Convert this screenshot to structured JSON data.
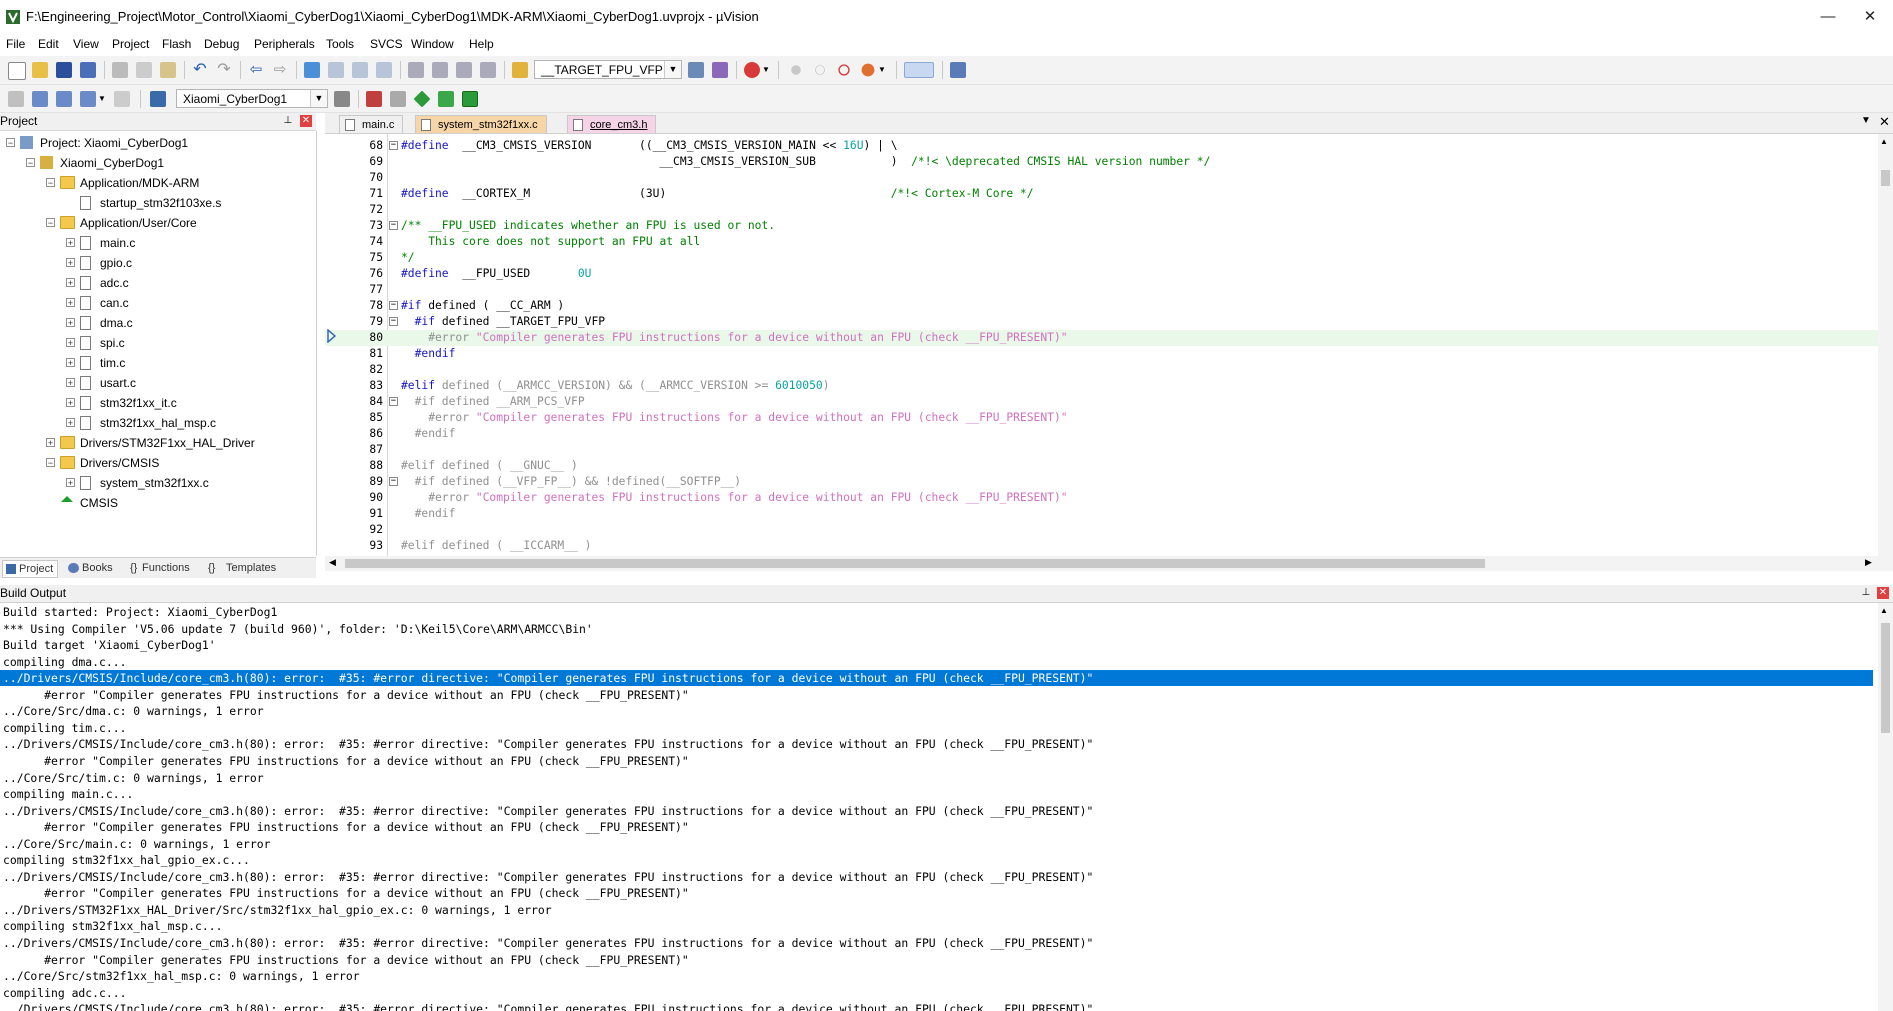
{
  "window": {
    "title": "F:\\Engineering_Project\\Motor_Control\\Xiaomi_CyberDog1\\Xiaomi_CyberDog1\\MDK-ARM\\Xiaomi_CyberDog1.uvprojx - µVision",
    "minimize": "—",
    "maximize": "☐",
    "close": "✕"
  },
  "menu": [
    "File",
    "Edit",
    "View",
    "Project",
    "Flash",
    "Debug",
    "Peripherals",
    "Tools",
    "SVCS",
    "Window",
    "Help"
  ],
  "toolbar": {
    "target_combo": "__TARGET_FPU_VFP",
    "project_combo": "Xiaomi_CyberDog1"
  },
  "project_panel": {
    "title": "Project",
    "tree": [
      {
        "label": "Project: Xiaomi_CyberDog1",
        "level": 0,
        "type": "project",
        "exp": "−"
      },
      {
        "label": "Xiaomi_CyberDog1",
        "level": 1,
        "type": "target",
        "exp": "−"
      },
      {
        "label": "Application/MDK-ARM",
        "level": 2,
        "type": "folder",
        "exp": "−"
      },
      {
        "label": "startup_stm32f103xe.s",
        "level": 3,
        "type": "file",
        "exp": ""
      },
      {
        "label": "Application/User/Core",
        "level": 2,
        "type": "folder",
        "exp": "−"
      },
      {
        "label": "main.c",
        "level": 3,
        "type": "file",
        "exp": "+"
      },
      {
        "label": "gpio.c",
        "level": 3,
        "type": "file",
        "exp": "+"
      },
      {
        "label": "adc.c",
        "level": 3,
        "type": "file",
        "exp": "+"
      },
      {
        "label": "can.c",
        "level": 3,
        "type": "file",
        "exp": "+"
      },
      {
        "label": "dma.c",
        "level": 3,
        "type": "file",
        "exp": "+"
      },
      {
        "label": "spi.c",
        "level": 3,
        "type": "file",
        "exp": "+"
      },
      {
        "label": "tim.c",
        "level": 3,
        "type": "file",
        "exp": "+"
      },
      {
        "label": "usart.c",
        "level": 3,
        "type": "file",
        "exp": "+"
      },
      {
        "label": "stm32f1xx_it.c",
        "level": 3,
        "type": "file",
        "exp": "+"
      },
      {
        "label": "stm32f1xx_hal_msp.c",
        "level": 3,
        "type": "file",
        "exp": "+"
      },
      {
        "label": "Drivers/STM32F1xx_HAL_Driver",
        "level": 2,
        "type": "folder",
        "exp": "+"
      },
      {
        "label": "Drivers/CMSIS",
        "level": 2,
        "type": "folder",
        "exp": "−"
      },
      {
        "label": "system_stm32f1xx.c",
        "level": 3,
        "type": "file",
        "exp": "+"
      },
      {
        "label": "CMSIS",
        "level": 2,
        "type": "gem",
        "exp": ""
      }
    ],
    "bottom_tabs": [
      "Project",
      "Books",
      "Functions",
      "Templates"
    ]
  },
  "editor": {
    "tabs": [
      {
        "label": "main.c",
        "active": false,
        "color": "#f0f0f0"
      },
      {
        "label": "system_stm32f1xx.c",
        "active": false,
        "color": "#f6d6a8"
      },
      {
        "label": "core_cm3.h",
        "active": true,
        "color": "#f4d4e6"
      }
    ],
    "lines": [
      {
        "n": "68",
        "fold": "−",
        "hl": false,
        "segs": [
          [
            "kw",
            "#define"
          ],
          [
            "",
            "  __CM3_CMSIS_VERSION       ((__CM3_CMSIS_VERSION_MAIN << "
          ],
          [
            "num",
            "16U"
          ],
          [
            "",
            ") | \\"
          ]
        ]
      },
      {
        "n": "69",
        "fold": "",
        "hl": false,
        "segs": [
          [
            "",
            "                                      __CM3_CMSIS_VERSION_SUB           )  "
          ],
          [
            "cm",
            "/*!< \\deprecated CMSIS HAL version number */"
          ]
        ]
      },
      {
        "n": "70",
        "fold": "",
        "hl": false,
        "segs": [
          [
            "",
            ""
          ]
        ]
      },
      {
        "n": "71",
        "fold": "",
        "hl": false,
        "segs": [
          [
            "kw",
            "#define"
          ],
          [
            "",
            "  __CORTEX_M                (3U)                                 "
          ],
          [
            "cm",
            "/*!< Cortex-M Core */"
          ]
        ]
      },
      {
        "n": "72",
        "fold": "",
        "hl": false,
        "segs": [
          [
            "",
            ""
          ]
        ]
      },
      {
        "n": "73",
        "fold": "−",
        "hl": false,
        "segs": [
          [
            "cm",
            "/** __FPU_USED indicates whether an FPU is used or not."
          ]
        ]
      },
      {
        "n": "74",
        "fold": "",
        "hl": false,
        "segs": [
          [
            "cm",
            "    This core does not support an FPU at all"
          ]
        ]
      },
      {
        "n": "75",
        "fold": "",
        "hl": false,
        "segs": [
          [
            "cm",
            "*/"
          ]
        ]
      },
      {
        "n": "76",
        "fold": "",
        "hl": false,
        "segs": [
          [
            "kw",
            "#define"
          ],
          [
            "",
            "  __FPU_USED       "
          ],
          [
            "num",
            "0U"
          ]
        ]
      },
      {
        "n": "77",
        "fold": "",
        "hl": false,
        "segs": [
          [
            "",
            ""
          ]
        ]
      },
      {
        "n": "78",
        "fold": "−",
        "hl": false,
        "segs": [
          [
            "kw",
            "#if"
          ],
          [
            "",
            " defined ( __CC_ARM )"
          ]
        ]
      },
      {
        "n": "79",
        "fold": "−",
        "hl": false,
        "segs": [
          [
            "",
            "  "
          ],
          [
            "kw",
            "#if"
          ],
          [
            "",
            " defined __TARGET_FPU_VFP"
          ]
        ]
      },
      {
        "n": "80",
        "fold": "",
        "hl": true,
        "segs": [
          [
            "dim",
            "    #error "
          ],
          [
            "lstr",
            "\"Compiler generates FPU instructions for a device without an FPU (check __FPU_PRESENT)\""
          ]
        ]
      },
      {
        "n": "81",
        "fold": "",
        "hl": false,
        "segs": [
          [
            "",
            "  "
          ],
          [
            "kw",
            "#endif"
          ]
        ]
      },
      {
        "n": "82",
        "fold": "",
        "hl": false,
        "segs": [
          [
            "",
            ""
          ]
        ]
      },
      {
        "n": "83",
        "fold": "",
        "hl": false,
        "segs": [
          [
            "kw",
            "#elif"
          ],
          [
            "dim",
            " defined (__ARMCC_VERSION) && (__ARMCC_VERSION >= "
          ],
          [
            "num",
            "6010050"
          ],
          [
            "dim",
            ")"
          ]
        ]
      },
      {
        "n": "84",
        "fold": "−",
        "hl": false,
        "segs": [
          [
            "dim",
            "  #if defined __ARM_PCS_VFP"
          ]
        ]
      },
      {
        "n": "85",
        "fold": "",
        "hl": false,
        "segs": [
          [
            "dim",
            "    #error "
          ],
          [
            "lstr",
            "\"Compiler generates FPU instructions for a device without an FPU (check __FPU_PRESENT)\""
          ]
        ]
      },
      {
        "n": "86",
        "fold": "",
        "hl": false,
        "segs": [
          [
            "dim",
            "  #endif"
          ]
        ]
      },
      {
        "n": "87",
        "fold": "",
        "hl": false,
        "segs": [
          [
            "",
            ""
          ]
        ]
      },
      {
        "n": "88",
        "fold": "",
        "hl": false,
        "segs": [
          [
            "dim",
            "#elif defined ( __GNUC__ )"
          ]
        ]
      },
      {
        "n": "89",
        "fold": "−",
        "hl": false,
        "segs": [
          [
            "dim",
            "  #if defined (__VFP_FP__) && !defined(__SOFTFP__)"
          ]
        ]
      },
      {
        "n": "90",
        "fold": "",
        "hl": false,
        "segs": [
          [
            "dim",
            "    #error "
          ],
          [
            "lstr",
            "\"Compiler generates FPU instructions for a device without an FPU (check __FPU_PRESENT)\""
          ]
        ]
      },
      {
        "n": "91",
        "fold": "",
        "hl": false,
        "segs": [
          [
            "dim",
            "  #endif"
          ]
        ]
      },
      {
        "n": "92",
        "fold": "",
        "hl": false,
        "segs": [
          [
            "",
            ""
          ]
        ]
      },
      {
        "n": "93",
        "fold": "",
        "hl": false,
        "segs": [
          [
            "dim",
            "#elif defined ( __ICCARM__ )"
          ]
        ]
      }
    ]
  },
  "build_output": {
    "title": "Build Output",
    "selected_index": 4,
    "lines": [
      "Build started: Project: Xiaomi_CyberDog1",
      "*** Using Compiler 'V5.06 update 7 (build 960)', folder: 'D:\\Keil5\\Core\\ARM\\ARMCC\\Bin'",
      "Build target 'Xiaomi_CyberDog1'",
      "compiling dma.c...",
      "../Drivers/CMSIS/Include/core_cm3.h(80): error:  #35: #error directive: \"Compiler generates FPU instructions for a device without an FPU (check __FPU_PRESENT)\"",
      "      #error \"Compiler generates FPU instructions for a device without an FPU (check __FPU_PRESENT)\"",
      "../Core/Src/dma.c: 0 warnings, 1 error",
      "compiling tim.c...",
      "../Drivers/CMSIS/Include/core_cm3.h(80): error:  #35: #error directive: \"Compiler generates FPU instructions for a device without an FPU (check __FPU_PRESENT)\"",
      "      #error \"Compiler generates FPU instructions for a device without an FPU (check __FPU_PRESENT)\"",
      "../Core/Src/tim.c: 0 warnings, 1 error",
      "compiling main.c...",
      "../Drivers/CMSIS/Include/core_cm3.h(80): error:  #35: #error directive: \"Compiler generates FPU instructions for a device without an FPU (check __FPU_PRESENT)\"",
      "      #error \"Compiler generates FPU instructions for a device without an FPU (check __FPU_PRESENT)\"",
      "../Core/Src/main.c: 0 warnings, 1 error",
      "compiling stm32f1xx_hal_gpio_ex.c...",
      "../Drivers/CMSIS/Include/core_cm3.h(80): error:  #35: #error directive: \"Compiler generates FPU instructions for a device without an FPU (check __FPU_PRESENT)\"",
      "      #error \"Compiler generates FPU instructions for a device without an FPU (check __FPU_PRESENT)\"",
      "../Drivers/STM32F1xx_HAL_Driver/Src/stm32f1xx_hal_gpio_ex.c: 0 warnings, 1 error",
      "compiling stm32f1xx_hal_msp.c...",
      "../Drivers/CMSIS/Include/core_cm3.h(80): error:  #35: #error directive: \"Compiler generates FPU instructions for a device without an FPU (check __FPU_PRESENT)\"",
      "      #error \"Compiler generates FPU instructions for a device without an FPU (check __FPU_PRESENT)\"",
      "../Core/Src/stm32f1xx_hal_msp.c: 0 warnings, 1 error",
      "compiling adc.c...",
      "../Drivers/CMSIS/Include/core_cm3.h(80): error:  #35: #error directive: \"Compiler generates FPU instructions for a device without an FPU (check __FPU_PRESENT)\""
    ]
  }
}
